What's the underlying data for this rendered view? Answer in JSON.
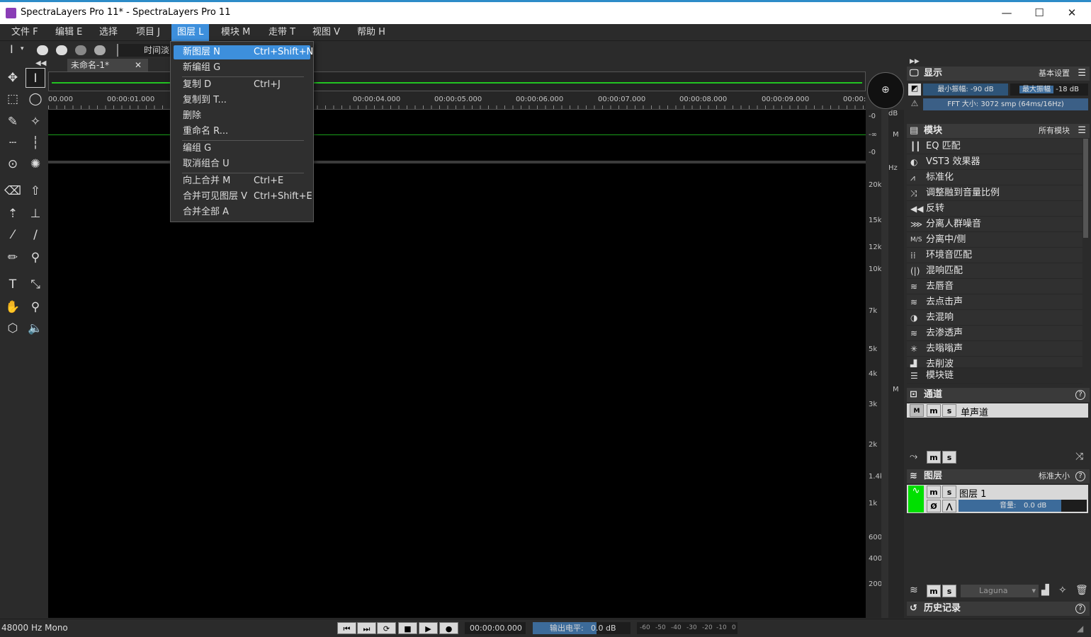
{
  "window": {
    "title": "SpectraLayers Pro 11* - SpectraLayers Pro 11",
    "minimize": "—",
    "maximize": "☐",
    "close": "✕"
  },
  "menu": [
    {
      "label": "文件 F"
    },
    {
      "label": "编辑 E"
    },
    {
      "label": "选择"
    },
    {
      "label": "项目 J"
    },
    {
      "label": "图层 L"
    },
    {
      "label": "模块 M"
    },
    {
      "label": "走带 T"
    },
    {
      "label": "视图 V"
    },
    {
      "label": "帮助 H"
    }
  ],
  "toolbar": {
    "fade_label": "时间淡"
  },
  "document": {
    "tab_label": "未命名-1*",
    "tab_close": "✕"
  },
  "ruler": {
    "ticks": [
      "00.000",
      "00:00:01.000",
      "00:00:04.000",
      "00:00:05.000",
      "00:00:06.000",
      "00:00:07.000",
      "00:00:08.000",
      "00:00:09.000",
      "00:00:"
    ]
  },
  "amp_axis": {
    "unit": "dB",
    "labels": [
      "-0",
      "-∞",
      "-0"
    ],
    "m": "M"
  },
  "freq_axis": {
    "unit": "Hz",
    "labels": [
      "20k",
      "15k",
      "12k",
      "10k",
      "7k",
      "5k",
      "4k",
      "3k",
      "2k",
      "1.4k",
      "1k",
      "600",
      "400",
      "200"
    ],
    "m": "M"
  },
  "layer_menu": {
    "items": [
      {
        "label": "新图层 N",
        "shortcut": "Ctrl+Shift+N"
      },
      {
        "label": "新编组 G",
        "shortcut": ""
      },
      {
        "label": "复制 D",
        "shortcut": "Ctrl+J"
      },
      {
        "label": "复制到 T...",
        "shortcut": ""
      },
      {
        "label": "删除",
        "shortcut": ""
      },
      {
        "label": "重命名 R...",
        "shortcut": ""
      },
      {
        "label": "编组 G",
        "shortcut": ""
      },
      {
        "label": "取消组合 U",
        "shortcut": ""
      },
      {
        "label": "向上合并 M",
        "shortcut": "Ctrl+E"
      },
      {
        "label": "合并可见图层 V",
        "shortcut": "Ctrl+Shift+E"
      },
      {
        "label": "合并全部 A",
        "shortcut": ""
      }
    ]
  },
  "display_panel": {
    "title": "显示",
    "preset": "基本设置",
    "min_amp_label": "最小振幅:",
    "min_amp_value": "-90 dB",
    "max_amp_label": "最大振幅",
    "max_amp_value": "-18 dB",
    "fft_label": "FFT 大小:",
    "fft_value": "3072 smp (64ms/16Hz)"
  },
  "modules_panel": {
    "title": "模块",
    "filter": "所有模块",
    "items": [
      "EQ 匹配",
      "VST3 效果器",
      "标准化",
      "调整融到音量比例",
      "反转",
      "分离人群噪音",
      "分离中/侧",
      "环境音匹配",
      "混响匹配",
      "去唇音",
      "去点击声",
      "去混响",
      "去渗透声",
      "去嗡嗡声",
      "去削波"
    ],
    "chain_label": "模块链"
  },
  "channels_panel": {
    "title": "通道",
    "channel_name": "单声道",
    "m_upper": "M",
    "m": "m",
    "s": "s"
  },
  "layers_panel": {
    "title": "图层",
    "size": "标准大小",
    "layer_name": "图层 1",
    "volume_label": "音量:",
    "volume_value": "0.0 dB",
    "blend_mode": "Laguna"
  },
  "history_panel": {
    "title": "历史记录"
  },
  "status": {
    "format": "48000 Hz Mono",
    "time": "00:00:00.000",
    "output_label": "输出电平:",
    "output_value": "0.0 dB",
    "meter_ticks": [
      "-60",
      "-50",
      "-40",
      "-30",
      "-20",
      "-10",
      "0"
    ]
  },
  "colors": {
    "accent": "#3d8fdc",
    "wave": "#22c422",
    "layer_thumb": "#00e000"
  }
}
